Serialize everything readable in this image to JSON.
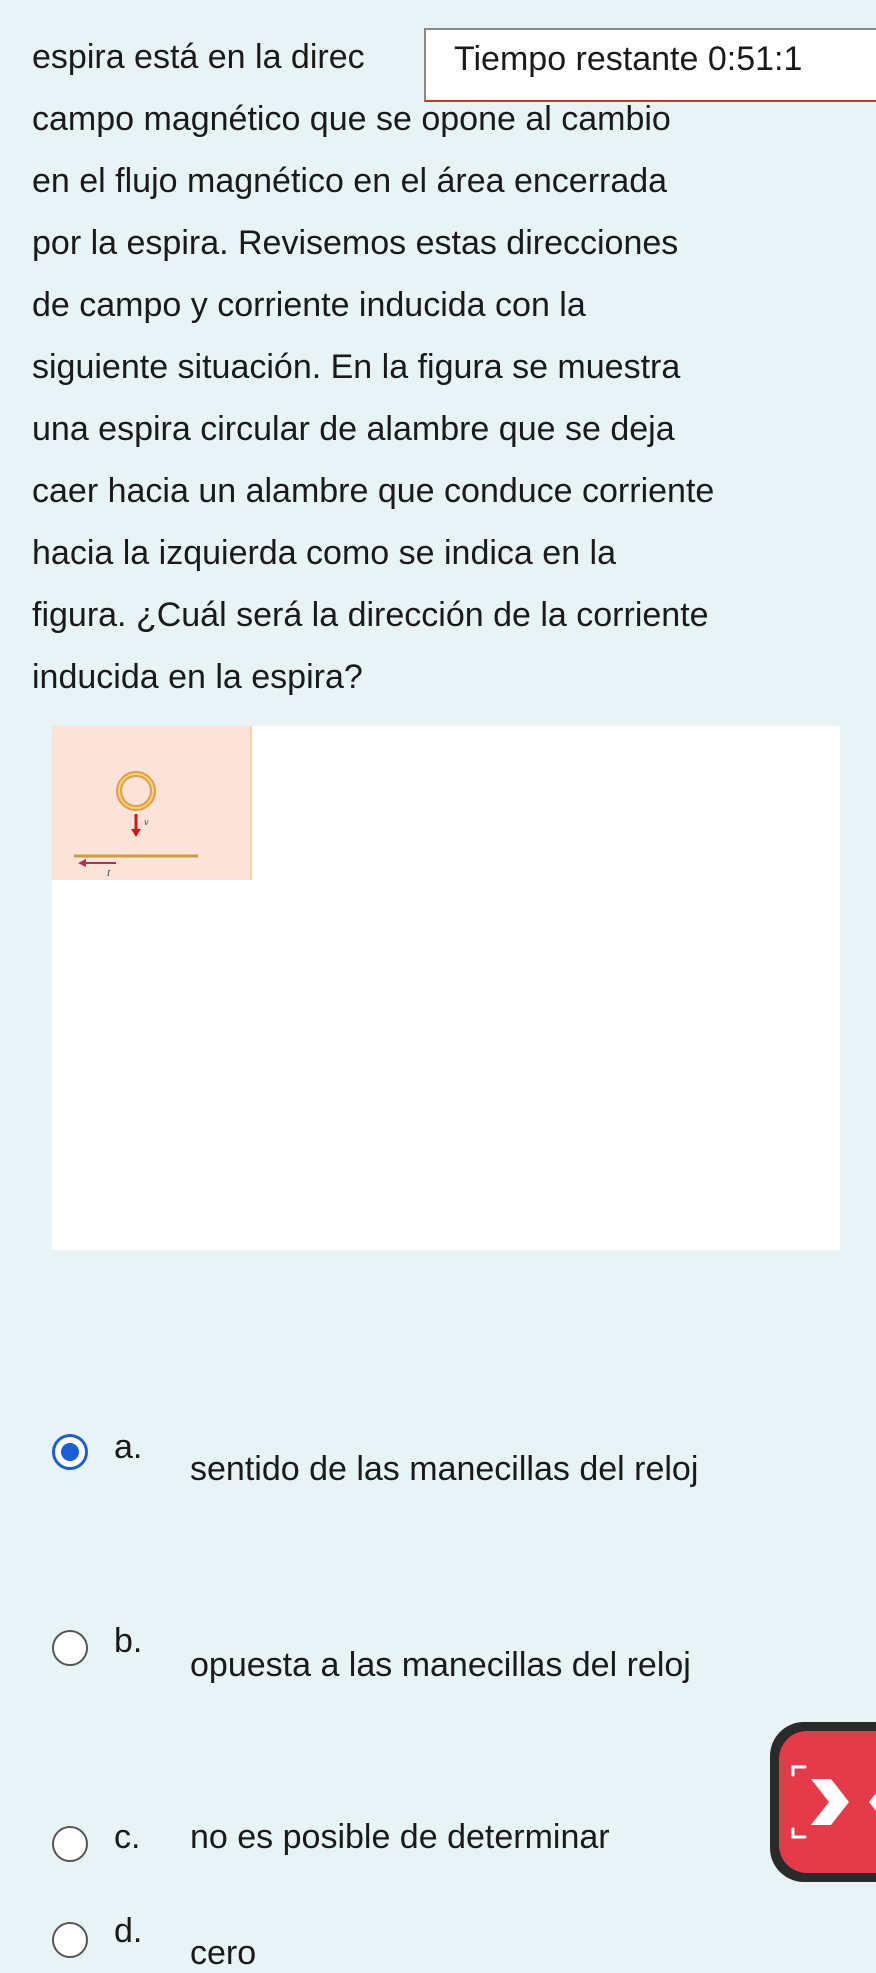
{
  "question": {
    "lines": [
      "espira está en la direc",
      "campo magnético que se opone al cambio",
      "en el flujo magnético en el área encerrada",
      "por la espira. Revisemos estas direcciones",
      "de campo y corriente inducida con la",
      "siguiente situación. En la figura se muestra",
      "una espira circular de alambre que se deja",
      "caer hacia un alambre que conduce corriente",
      "hacia la izquierda como se indica en la",
      "figura. ¿Cuál será la dirección de la corriente",
      "inducida en la espira?"
    ]
  },
  "timer": {
    "label": "Tiempo restante 0:51:1"
  },
  "figure": {
    "velocity_label": "v",
    "current_label": "I",
    "colors": {
      "loop": "#e0a040",
      "velocity_arrow": "#d01a1a",
      "wire": "#c8a040",
      "current_arrow": "#b03060"
    }
  },
  "options": [
    {
      "letter": "a.",
      "text": "sentido de las manecillas del reloj",
      "selected": true
    },
    {
      "letter": "b.",
      "text": "opuesta a las manecillas del reloj",
      "selected": false
    },
    {
      "letter": "c.",
      "text": "no es posible de determinar",
      "selected": false
    },
    {
      "letter": "d.",
      "text": "cero",
      "selected": false
    }
  ],
  "colors": {
    "background": "#e7f3f5",
    "radio_selected": "#1a5fd6",
    "floating_button": "#e53a4a"
  },
  "floating_button": {
    "icon": "close-icon"
  }
}
